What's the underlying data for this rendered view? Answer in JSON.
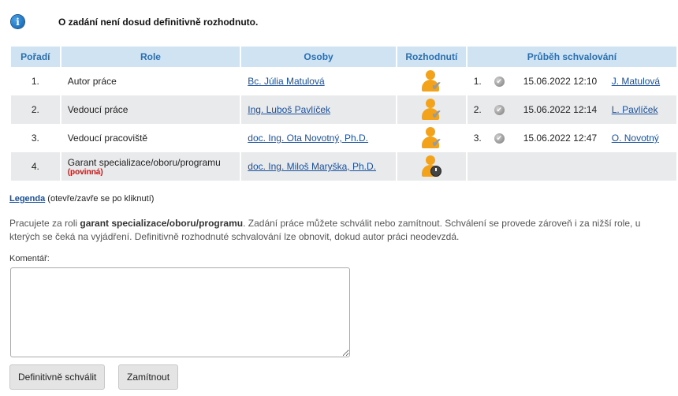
{
  "notice": {
    "icon": "info-icon",
    "text": "O zadání není dosud definitivně rozhodnuto."
  },
  "table": {
    "headers": [
      "Pořadí",
      "Role",
      "Osoby",
      "Rozhodnutí",
      "Průběh schvalování"
    ],
    "rows": [
      {
        "num": "1.",
        "role": "Autor práce",
        "person": "Bc. Júlia Matulová",
        "decision_icon": "person-approved-icon",
        "progress": {
          "num": "1.",
          "icon": "approved-tick-icon",
          "date": "15.06.2022 12:10",
          "person": "J. Matulová"
        }
      },
      {
        "num": "2.",
        "role": "Vedoucí práce",
        "person": "Ing. Luboš Pavlíček",
        "decision_icon": "person-approved-icon",
        "progress": {
          "num": "2.",
          "icon": "approved-tick-icon",
          "date": "15.06.2022 12:14",
          "person": "L. Pavlíček"
        }
      },
      {
        "num": "3.",
        "role": "Vedoucí pracoviště",
        "person": "doc. Ing. Ota Novotný, Ph.D.",
        "decision_icon": "person-approved-icon",
        "progress": {
          "num": "3.",
          "icon": "approved-tick-icon",
          "date": "15.06.2022 12:47",
          "person": "O. Novotný"
        }
      },
      {
        "num": "4.",
        "role": "Garant specializace/oboru/programu",
        "role_note": "(povinná)",
        "person": "doc. Ing. Miloš Maryška, Ph.D.",
        "decision_icon": "person-pending-icon"
      }
    ]
  },
  "legend": {
    "link": "Legenda",
    "hint": "(otevře/zavře se po kliknutí)"
  },
  "info": {
    "part1": "Pracujete za roli ",
    "role": "garant specializace/oboru/programu",
    "part2": ". Zadání práce můžete schválit nebo zamítnout. Schválení se provede zároveň i za nižší role, u kterých se čeká na vyjádření. Definitivně rozhodnuté schvalování lze obnovit, dokud autor práci neodevzdá."
  },
  "comment": {
    "label": "Komentář:",
    "value": ""
  },
  "buttons": {
    "approve": "Definitivně schválit",
    "reject": "Zamítnout"
  }
}
